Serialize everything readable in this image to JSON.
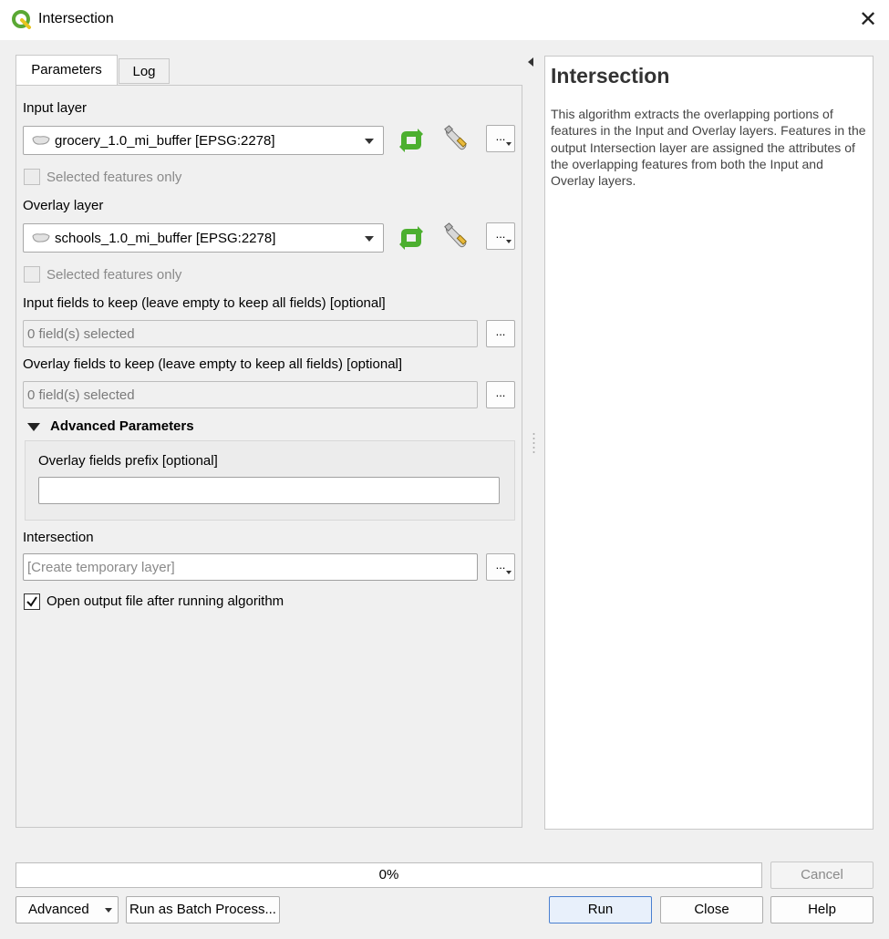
{
  "window": {
    "title": "Intersection"
  },
  "tabs": [
    {
      "label": "Parameters"
    },
    {
      "label": "Log"
    }
  ],
  "input_layer": {
    "label": "Input layer",
    "value": "grocery_1.0_mi_buffer [EPSG:2278]",
    "selected_only_label": "Selected features only",
    "dots_label": "..."
  },
  "overlay_layer": {
    "label": "Overlay layer",
    "value": "schools_1.0_mi_buffer [EPSG:2278]",
    "selected_only_label": "Selected features only",
    "dots_label": "..."
  },
  "input_fields": {
    "label": "Input fields to keep (leave empty to keep all fields) [optional]",
    "value": "0 field(s) selected",
    "dots_label": "..."
  },
  "overlay_fields": {
    "label": "Overlay fields to keep (leave empty to keep all fields) [optional]",
    "value": "0 field(s) selected",
    "dots_label": "..."
  },
  "advanced": {
    "header": "Advanced Parameters",
    "prefix_label": "Overlay fields prefix [optional]",
    "prefix_value": ""
  },
  "output": {
    "label": "Intersection",
    "placeholder": "[Create temporary layer]",
    "dots_label": "...",
    "open_after_label": "Open output file after running algorithm",
    "open_after_checked": true
  },
  "help": {
    "title": "Intersection",
    "body": "This algorithm extracts the overlapping portions of features in the Input and Overlay layers. Features in the output Intersection layer are assigned the attributes of the overlapping features from both the Input and Overlay layers."
  },
  "progress": {
    "text": "0%",
    "value": 0
  },
  "buttons": {
    "cancel": "Cancel",
    "advanced": "Advanced",
    "batch": "Run as Batch Process...",
    "run": "Run",
    "close": "Close",
    "help": "Help"
  },
  "colors": {
    "qgis_green": "#5aa834",
    "refresh_green": "#4caf2f"
  }
}
